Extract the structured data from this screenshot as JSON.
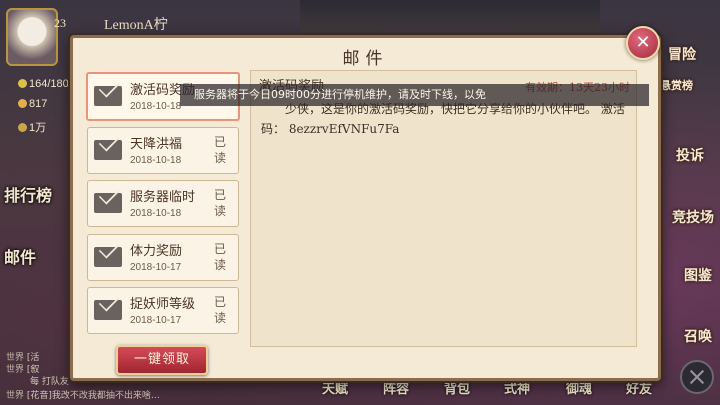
{
  "player": {
    "level": "23",
    "name": "LemonA柠"
  },
  "stats": [
    {
      "icon": "stamina-icon",
      "value": "164/180"
    },
    {
      "icon": "coin-icon",
      "value": "817"
    },
    {
      "icon": "jade-icon",
      "value": "1万"
    }
  ],
  "left_menu": [
    "排行榜",
    "邮件"
  ],
  "right_menu": [
    "冒险",
    "悬赏榜",
    "投诉",
    "竞技场",
    "图鉴",
    "召唤"
  ],
  "bottom_menu": [
    "天赋",
    "阵容",
    "背包",
    "式神",
    "御魂",
    "好友"
  ],
  "chat": [
    {
      "tag": "世界",
      "text": "[活"
    },
    {
      "tag": "世界",
      "text": "[叙"
    },
    {
      "tag": "",
      "text": "每 打队友"
    },
    {
      "tag": "世界",
      "text": "[花音]我改不改我都抽不出来啥…"
    }
  ],
  "mail": {
    "title": "邮件",
    "claim_all_label": "一键领取",
    "items": [
      {
        "title": "激活码奖励",
        "date": "2018-10-18",
        "read": "",
        "selected": true
      },
      {
        "title": "天降洪福",
        "date": "2018-10-18",
        "read": "已读"
      },
      {
        "title": "服务器临时",
        "date": "2018-10-18",
        "read": "已读"
      },
      {
        "title": "体力奖励",
        "date": "2018-10-17",
        "read": "已读"
      },
      {
        "title": "捉妖师等级",
        "date": "2018-10-17",
        "read": "已读"
      }
    ],
    "content": {
      "heading": "激活码奖励",
      "expire": "有效期：13天23小时",
      "body": "少侠，这是你的激活码奖励，快把它分享给你的小伙伴吧。 激活码： 8ezzrvEfVNFu7Fa"
    }
  },
  "system_notice": "服务器将于今日09时00分进行停机维护，请及时下线，以免"
}
